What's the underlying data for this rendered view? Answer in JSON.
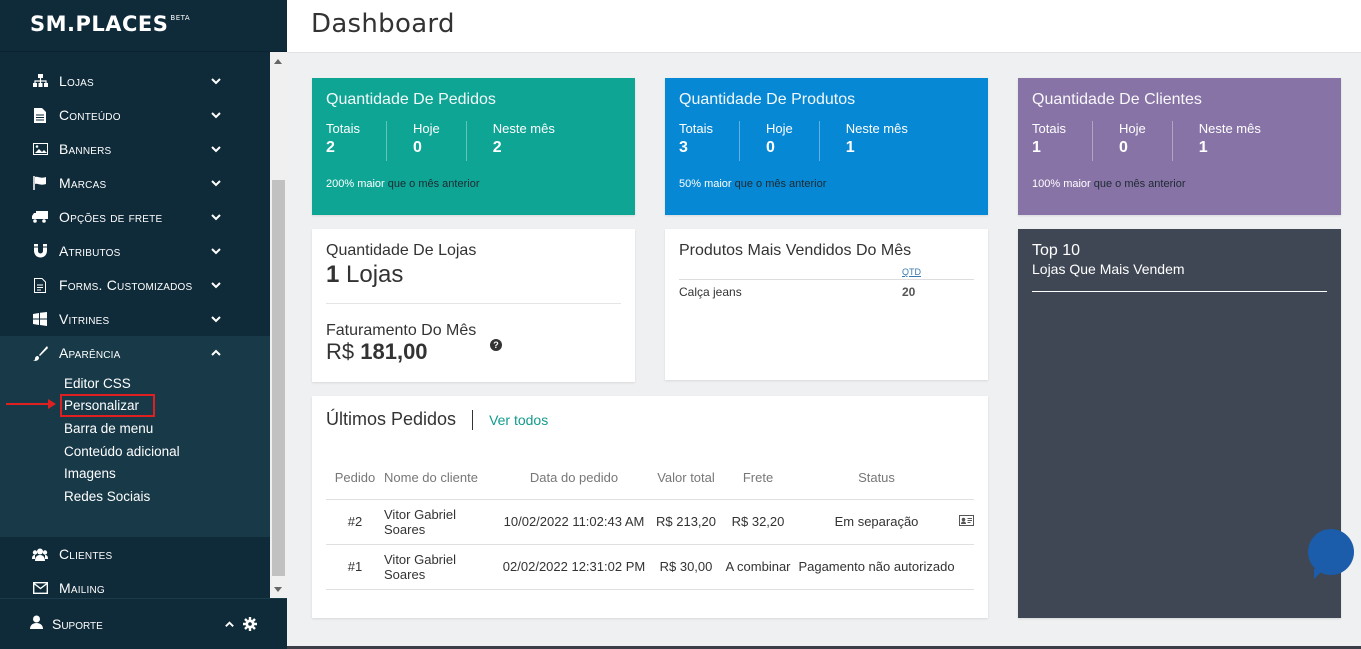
{
  "brand": {
    "name": "SM.PLACES",
    "tag": "BETA"
  },
  "nav": {
    "items": [
      {
        "label": "Lojas",
        "icon": "sitemap-icon"
      },
      {
        "label": "Conteúdo",
        "icon": "file-icon"
      },
      {
        "label": "Banners",
        "icon": "image-icon"
      },
      {
        "label": "Marcas",
        "icon": "flag-icon"
      },
      {
        "label": "Opções de frete",
        "icon": "truck-icon"
      },
      {
        "label": "Atributos",
        "icon": "magnet-icon"
      },
      {
        "label": "Forms. Customizados",
        "icon": "form-icon"
      },
      {
        "label": "Vitrines",
        "icon": "windows-icon"
      },
      {
        "label": "Aparência",
        "icon": "paintbrush-icon"
      }
    ],
    "sub_items": [
      "Editor CSS",
      "Personalizar",
      "Barra de menu",
      "Conteúdo adicional",
      "Imagens",
      "Redes Sociais"
    ],
    "after_items": [
      {
        "label": "Clientes",
        "icon": "users-icon"
      },
      {
        "label": "Mailing",
        "icon": "envelope-icon"
      }
    ],
    "footer_label": "Suporte"
  },
  "header": {
    "title": "Dashboard"
  },
  "stats": {
    "pedidos": {
      "title": "Quantidade De Pedidos",
      "totais_label": "Totais",
      "totais": "2",
      "hoje_label": "Hoje",
      "hoje": "0",
      "mes_label": "Neste mês",
      "mes": "2",
      "foot_strong": "200% maior",
      "foot_rest": "que o mês anterior"
    },
    "produtos": {
      "title": "Quantidade De Produtos",
      "totais_label": "Totais",
      "totais": "3",
      "hoje_label": "Hoje",
      "hoje": "0",
      "mes_label": "Neste mês",
      "mes": "1",
      "foot_strong": "50% maior",
      "foot_rest": "que o mês anterior"
    },
    "clientes": {
      "title": "Quantidade De Clientes",
      "totais_label": "Totais",
      "totais": "1",
      "hoje_label": "Hoje",
      "hoje": "0",
      "mes_label": "Neste mês",
      "mes": "1",
      "foot_strong": "100% maior",
      "foot_rest": "que o mês anterior"
    }
  },
  "lojas": {
    "title": "Quantidade De Lojas",
    "count": "1",
    "unit": "Lojas",
    "fat_title": "Faturamento Do Mês",
    "currency": "R$",
    "fat_value": "181,00"
  },
  "mais_vendidos": {
    "title": "Produtos Mais Vendidos Do Mês",
    "qtd_label": "QTD",
    "rows": [
      {
        "name": "Calça jeans",
        "qtd": "20"
      }
    ]
  },
  "top10": {
    "title": "Top 10",
    "subtitle": "Lojas Que Mais Vendem"
  },
  "orders": {
    "title": "Últimos Pedidos",
    "ver_todos": "Ver todos",
    "headers": [
      "Pedido",
      "Nome do cliente",
      "Data do pedido",
      "Valor total",
      "Frete",
      "Status"
    ],
    "rows": [
      {
        "id": "#2",
        "cliente": "Vitor Gabriel Soares",
        "data": "10/02/2022 11:02:43 AM",
        "valor": "R$ 213,20",
        "frete": "R$ 32,20",
        "status": "Em separação"
      },
      {
        "id": "#1",
        "cliente": "Vitor Gabriel Soares",
        "data": "02/02/2022 12:31:02 PM",
        "valor": "R$ 30,00",
        "frete": "A combinar",
        "status": "Pagamento não autorizado"
      }
    ]
  },
  "colors": {
    "sidebar": "#0f2a38",
    "teal": "#0ea595",
    "blue": "#0788d4",
    "purple": "#8773a6",
    "dark_card": "#3f4754",
    "link": "#3a78b0",
    "highlight": "#e02020"
  }
}
